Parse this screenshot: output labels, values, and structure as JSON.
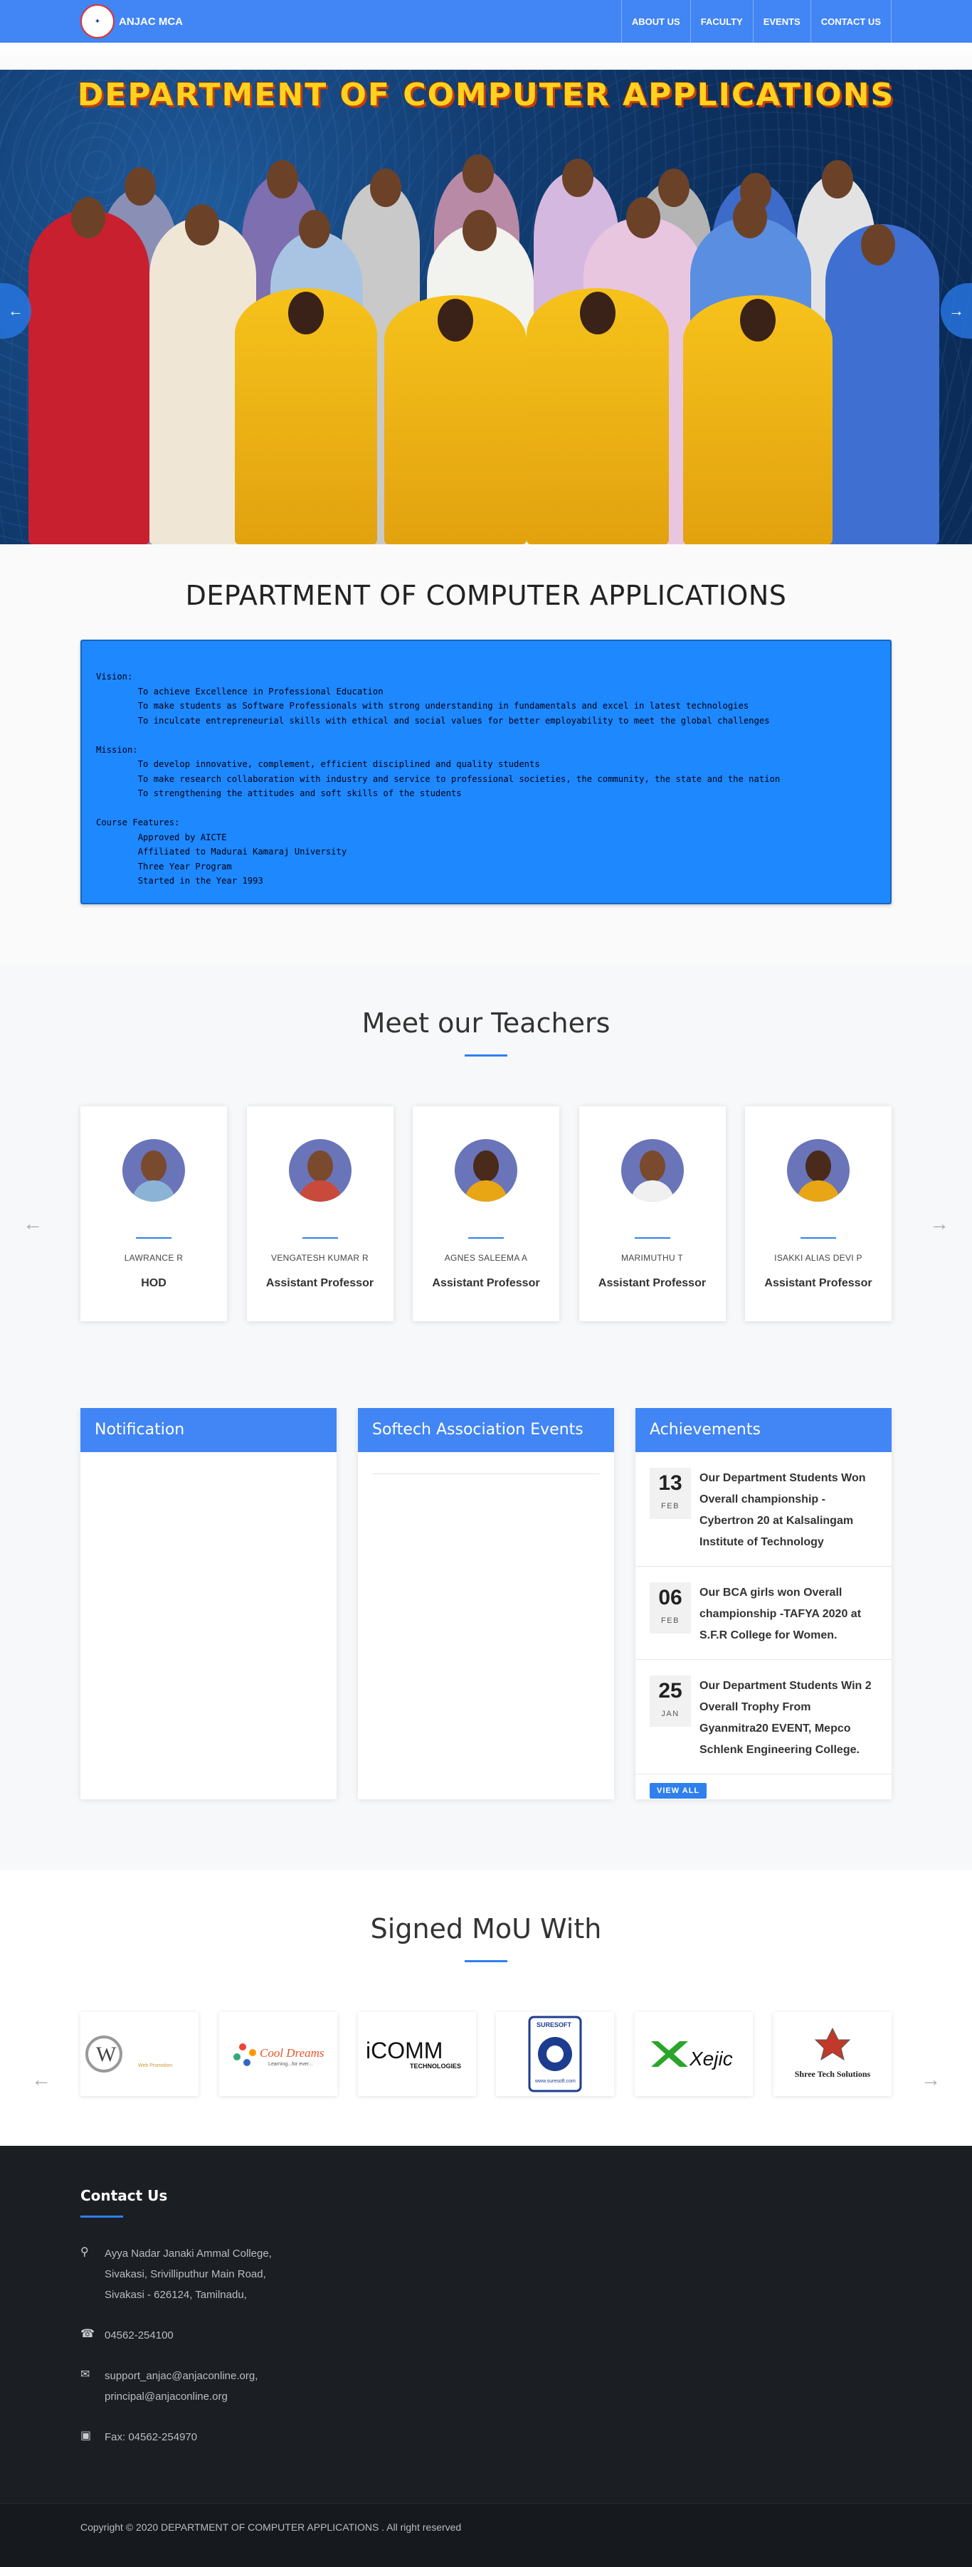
{
  "nav": {
    "brand": "ANJAC MCA",
    "items": [
      {
        "label": "ABOUT US"
      },
      {
        "label": "FACULTY"
      },
      {
        "label": "EVENTS"
      },
      {
        "label": "CONTACT US"
      }
    ]
  },
  "hero": {
    "banner_text": "DEPARTMENT OF COMPUTER APPLICATIONS",
    "prev_icon": "arrow-left-icon",
    "next_icon": "arrow-right-icon"
  },
  "about": {
    "title": "DEPARTMENT OF COMPUTER APPLICATIONS",
    "text": "Vision:\n        To achieve Excellence in Professional Education\n        To make students as Software Professionals with strong understanding in fundamentals and excel in latest technologies\n        To inculcate entrepreneurial skills with ethical and social values for better employability to meet the global challenges\n\nMission:\n        To develop innovative, complement, efficient disciplined and quality students\n        To make research collaboration with industry and service to professional societies, the community, the state and the nation\n        To strengthening the attitudes and soft skills of the students\n\nCourse Features:\n        Approved by AICTE\n        Affiliated to Madurai Kamaraj University\n        Three Year Program\n        Started in the Year 1993"
  },
  "teachers": {
    "title": "Meet our Teachers",
    "items": [
      {
        "name": "LAWRANCE R",
        "role": "HOD"
      },
      {
        "name": "VENGATESH KUMAR R",
        "role": "Assistant Professor"
      },
      {
        "name": "AGNES SALEEMA A",
        "role": "Assistant Professor"
      },
      {
        "name": "MARIMUTHU T",
        "role": "Assistant Professor"
      },
      {
        "name": "ISAKKI ALIAS DEVI P",
        "role": "Assistant Professor"
      }
    ]
  },
  "panels": {
    "notification_title": "Notification",
    "events_title": "Softech Association Events",
    "achievements_title": "Achievements",
    "achievements": [
      {
        "day": "13",
        "month": "FEB",
        "text": "Our Department Students Won Overall championship - Cybertron 20 at Kalsalingam Institute of Technology"
      },
      {
        "day": "06",
        "month": "FEB",
        "text": "Our BCA girls won Overall championship -TAFYA 2020 at S.F.R College for Women."
      },
      {
        "day": "25",
        "month": "JAN",
        "text": "Our Department Students Win 2 Overall Trophy From Gyanmitra20 EVENT, Mepco Schlenk Engineering College."
      }
    ],
    "view_all": "VIEW ALL"
  },
  "mou": {
    "title": "Signed MoU With",
    "logos": [
      {
        "label": "W",
        "tagline": "Web Promotion"
      },
      {
        "label": "Cool Dreams",
        "tagline": "Learning...for ever..."
      },
      {
        "label": "iCOMM",
        "tagline": "TECHNOLOGIES"
      },
      {
        "label": "SURESOFT",
        "tagline": "www.suresoft.com"
      },
      {
        "label": "Xejic",
        "tagline": ""
      },
      {
        "label": "Shree Tech Solutions",
        "tagline": ""
      }
    ]
  },
  "footer": {
    "heading": "Contact Us",
    "address": "Ayya Nadar Janaki Ammal College, Sivakasi, Srivilliputhur Main Road, Sivakasi - 626124, Tamilnadu,",
    "phone": "04562-254100",
    "email": "support_anjac@anjaconline.org, principal@anjaconline.org",
    "fax": "Fax: 04562-254970",
    "copyright": "Copyright © 2020 DEPARTMENT OF COMPUTER APPLICATIONS . All right reserved"
  },
  "colors": {
    "primary": "#4285f4",
    "accent": "#2f80ed",
    "about_box": "#1e88ff",
    "footer_bg": "#1b1e23"
  }
}
